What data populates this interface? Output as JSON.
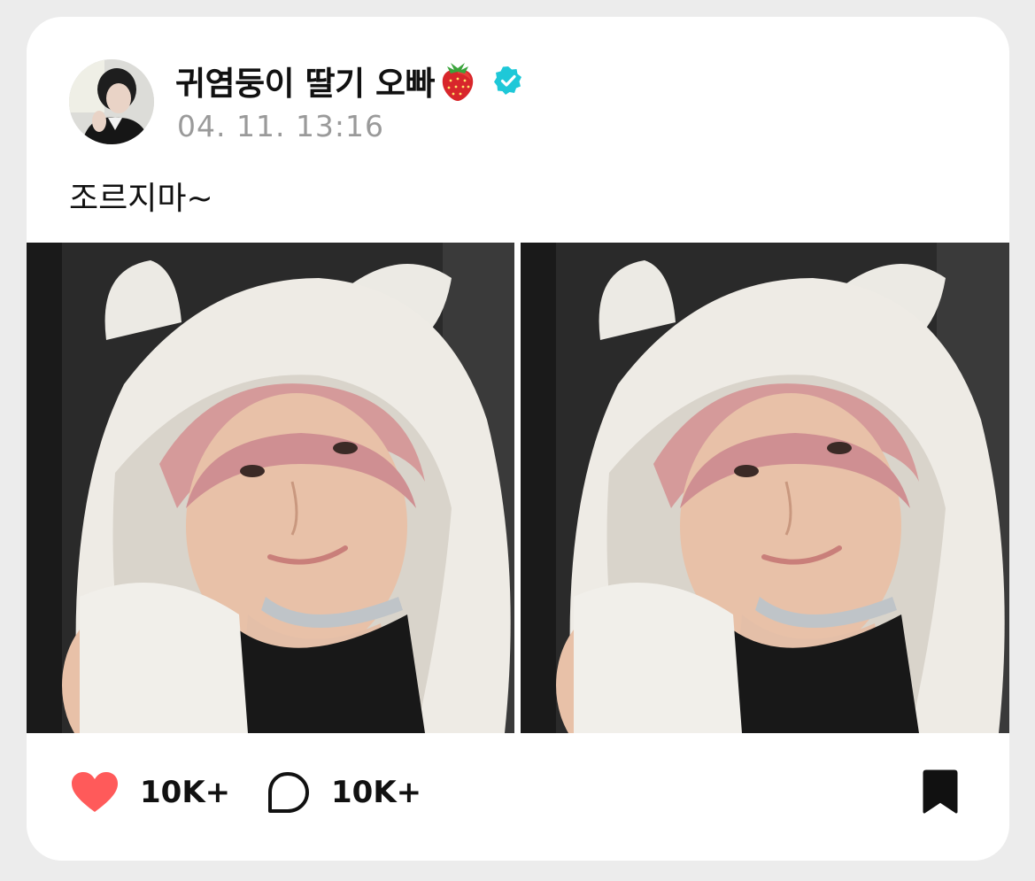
{
  "post": {
    "author_name": "귀염둥이 딸기 오빠",
    "author_emoji": "strawberry-emoji",
    "verified_icon": "verified-badge-icon",
    "timestamp": "04. 11. 13:16",
    "caption": "조르지마~",
    "photos": [
      {
        "description_icon": "selfie-photo"
      },
      {
        "description_icon": "selfie-photo"
      }
    ]
  },
  "actions": {
    "like_icon": "heart-icon",
    "like_count": "10K+",
    "comment_icon": "comment-bubble-icon",
    "comment_count": "10K+",
    "bookmark_icon": "bookmark-icon"
  },
  "colors": {
    "verified": "#1ec8d8",
    "heart": "#ff5a5a",
    "text": "#111111",
    "timestamp": "#9a9a9a"
  }
}
